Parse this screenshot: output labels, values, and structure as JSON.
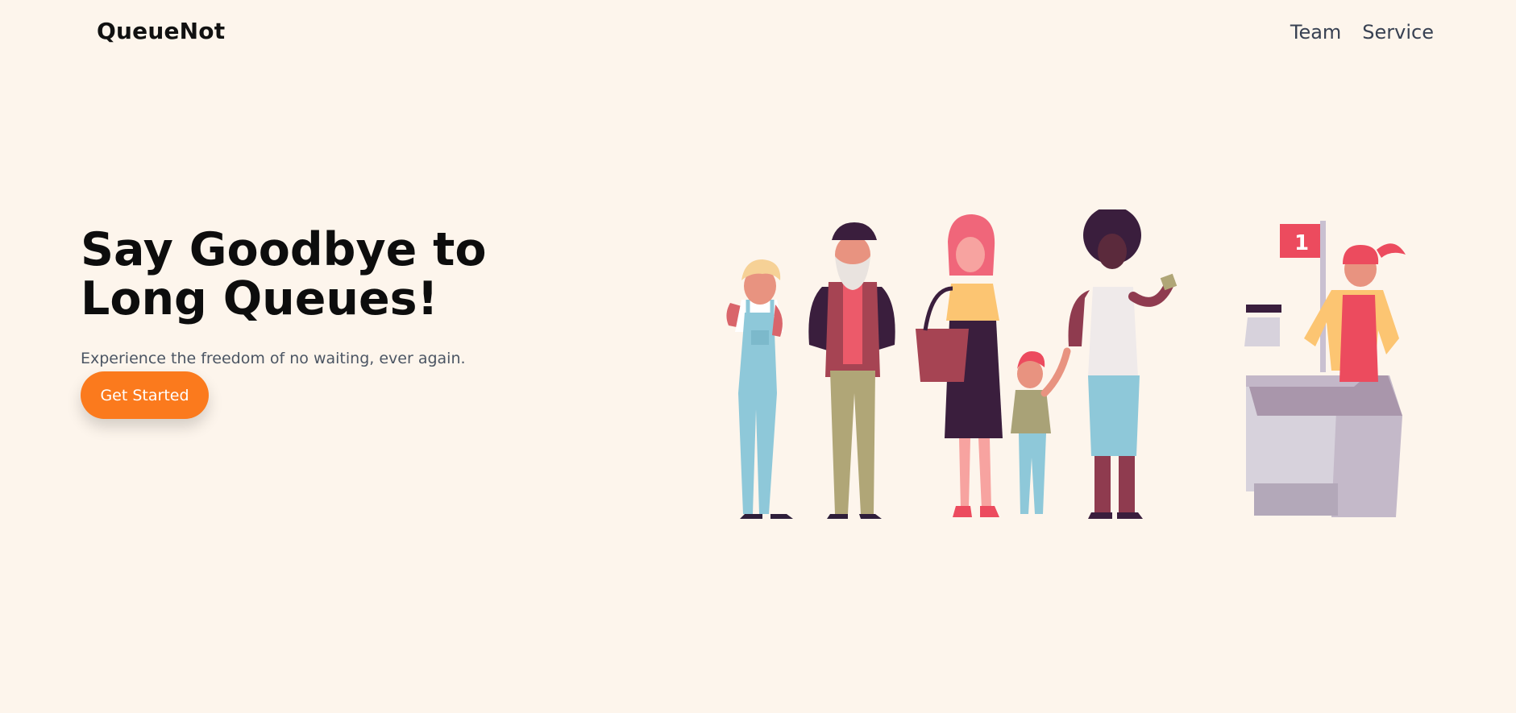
{
  "brand": {
    "name": "QueueNot"
  },
  "nav": {
    "items": [
      {
        "label": "Team"
      },
      {
        "label": "Service"
      }
    ]
  },
  "hero": {
    "title": "Say Goodbye to Long Queues!",
    "subtitle": "Experience the freedom of no waiting, ever again.",
    "cta_label": "Get Started",
    "flag_number": "1"
  },
  "colors": {
    "background": "#fdf5ec",
    "accent": "#fb7a1d",
    "text_dark": "#0d0d0d",
    "nav_text": "#384152"
  }
}
